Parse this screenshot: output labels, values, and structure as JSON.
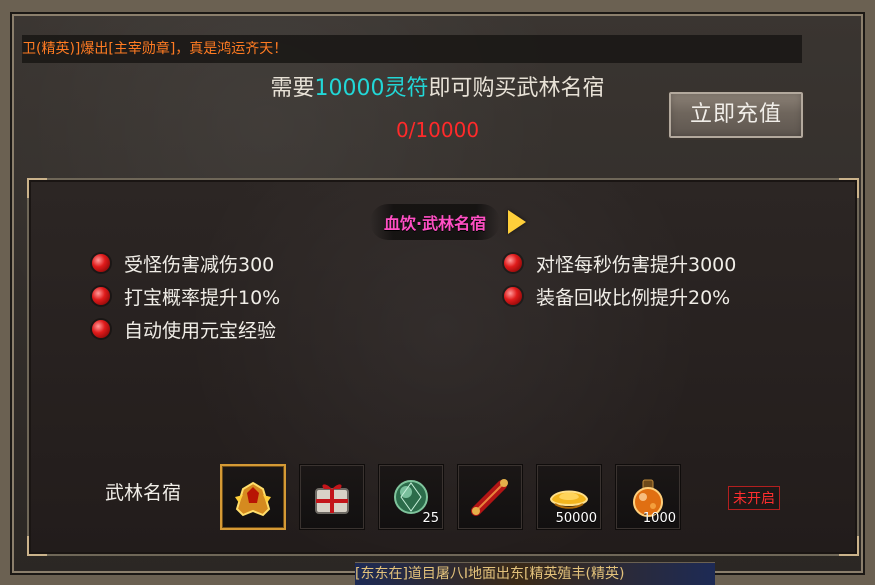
{
  "announcement": {
    "text": "卫(精英)]爆出[主宰勋章]，真是鸿运齐天！"
  },
  "purchase": {
    "prefix": "需要",
    "amount": "10000灵符",
    "suffix": "即可购买武林名宿",
    "progress": "0/10000"
  },
  "recharge_button": {
    "label": "立即充值"
  },
  "panel": {
    "title": "血饮·武林名宿",
    "effects_left": [
      "受怪伤害减伤300",
      "打宝概率提升10%",
      "自动使用元宝经验"
    ],
    "effects_right": [
      "对怪每秒伤害提升3000",
      "装备回收比例提升20%"
    ],
    "rank_label": "武林名宿",
    "items": [
      {
        "icon": "golden-helmet-icon",
        "count": ""
      },
      {
        "icon": "gift-box-icon",
        "count": ""
      },
      {
        "icon": "green-gem-icon",
        "count": "25"
      },
      {
        "icon": "red-scroll-icon",
        "count": ""
      },
      {
        "icon": "gold-ingot-icon",
        "count": "50000"
      },
      {
        "icon": "orange-potion-icon",
        "count": "1000"
      }
    ],
    "status_badge": "未开启"
  },
  "bottom_strip": {
    "text": "[东东在]道目屠八I地面出东[精英殖丰(精英)"
  },
  "colors": {
    "highlight_amount": "#22d7d7",
    "progress_red": "#ff2a2a",
    "title_pink": "#ff4fc4",
    "announcement_orange": "#ff7b22"
  }
}
